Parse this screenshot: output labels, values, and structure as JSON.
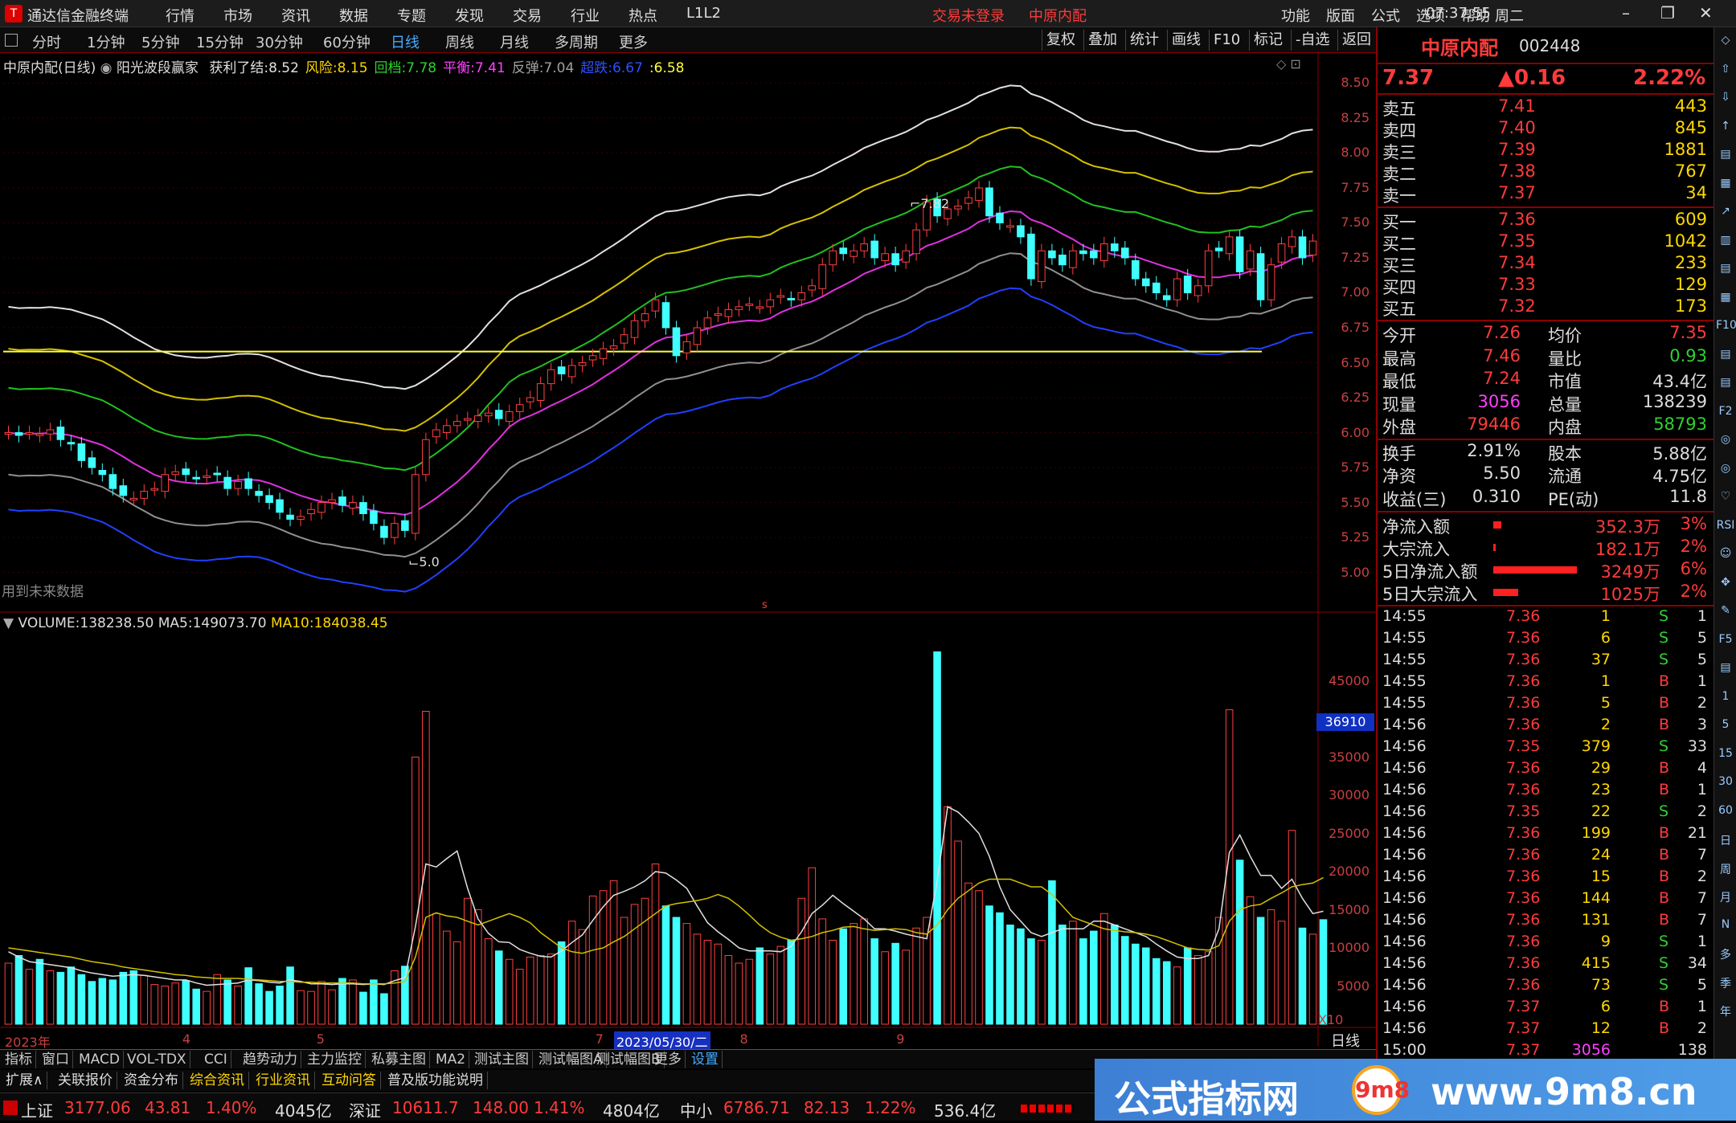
{
  "titlebar": {
    "app": "通达信金融终端",
    "menus": [
      "行情",
      "市场",
      "资讯",
      "数据",
      "专题",
      "发现",
      "交易",
      "行业",
      "热点",
      "L1L2"
    ],
    "status_login": "交易未登录",
    "stock": "中原内配",
    "right_menus": [
      "功能",
      "版面",
      "公式",
      "选项",
      "帮助"
    ],
    "time": "07:37:55",
    "weekday": "周二",
    "win": [
      "–",
      "❐",
      "✕"
    ]
  },
  "toolbar": {
    "periods": [
      "分时",
      "1分钟",
      "5分钟",
      "15分钟",
      "30分钟",
      "60分钟",
      "日线",
      "周线",
      "月线",
      "多周期",
      "更多"
    ],
    "active": "日线",
    "right": [
      "复权",
      "叠加",
      "统计",
      "画线",
      "F10",
      "标记",
      "-自选",
      "返回"
    ]
  },
  "indicator_line": {
    "name": "中原内配(日线)",
    "formula": "阳光波段赢家",
    "items": [
      {
        "label": "获利了结:",
        "value": "8.52",
        "color": "#e0e0e0"
      },
      {
        "label": "风险:",
        "value": "8.15",
        "color": "#ffd700"
      },
      {
        "label": "回档:",
        "value": "7.78",
        "color": "#30d030"
      },
      {
        "label": "平衡:",
        "value": "7.41",
        "color": "#ff40ff"
      },
      {
        "label": "反弹:",
        "value": "7.04",
        "color": "#a0a0a0"
      },
      {
        "label": "超跌:",
        "value": "6.67",
        "color": "#3050ff"
      },
      {
        "label": ":",
        "value": "6.58",
        "color": "#ffff40"
      }
    ]
  },
  "price_axis": [
    "8.50",
    "8.25",
    "8.00",
    "7.75",
    "7.50",
    "7.25",
    "7.00",
    "6.75",
    "6.50",
    "6.25",
    "6.00",
    "5.75",
    "5.50",
    "5.25",
    "5.00"
  ],
  "annotations": {
    "high": "7.82",
    "low": "5.0",
    "future": "用到未来数据",
    "s_mark": "s"
  },
  "volume_line": {
    "label": "VOLUME:",
    "value": "138238.50",
    "ma5_label": "MA5:",
    "ma5": "149073.70",
    "ma10_label": "MA10:",
    "ma10": "184038.45"
  },
  "volume_axis": [
    "45000",
    "40000",
    "35000",
    "30000",
    "25000",
    "20000",
    "15000",
    "10000",
    "5000"
  ],
  "volume_cursor": "36910",
  "volume_unit": "X10",
  "date_axis": {
    "labels": [
      "2023年",
      "4",
      "5",
      "7",
      "8",
      "9"
    ],
    "cursor": "2023/05/30/二",
    "period": "日线"
  },
  "bottom_tabs": [
    "指标",
    "窗口",
    "MACD",
    "VOL-TDX",
    "CCI",
    "趋势动力",
    "主力监控",
    "私募主图",
    "MA2",
    "测试主图",
    "测试幅图A",
    "测试幅图B",
    "更多",
    "设置"
  ],
  "bottom_tabs2": [
    "扩展∧",
    "关联报价",
    "资金分布",
    "综合资讯",
    "行业资讯",
    "互动问答",
    "普及版功能说明"
  ],
  "statusbar": [
    {
      "name": "上证",
      "v": "3177.06",
      "c": "43.81",
      "p": "1.40%",
      "amt": "4045亿"
    },
    {
      "name": "深证",
      "v": "10611.7",
      "c": "148.00",
      "p": "1.41%",
      "amt": "4804亿"
    },
    {
      "name": "中小",
      "v": "6786.71",
      "c": "82.13",
      "p": "1.22%",
      "amt": "536.4亿"
    }
  ],
  "quote": {
    "name": "中原内配",
    "code": "002448",
    "price": "7.37",
    "change": "▲0.16",
    "pct": "2.22%",
    "asks": [
      [
        "卖五",
        "7.41",
        "443"
      ],
      [
        "卖四",
        "7.40",
        "845"
      ],
      [
        "卖三",
        "7.39",
        "1881"
      ],
      [
        "卖二",
        "7.38",
        "767"
      ],
      [
        "卖一",
        "7.37",
        "34"
      ]
    ],
    "bids": [
      [
        "买一",
        "7.36",
        "609"
      ],
      [
        "买二",
        "7.35",
        "1042"
      ],
      [
        "买三",
        "7.34",
        "233"
      ],
      [
        "买四",
        "7.33",
        "129"
      ],
      [
        "买五",
        "7.32",
        "173"
      ]
    ],
    "stats": [
      [
        "今开",
        "7.26",
        "均价",
        "7.35"
      ],
      [
        "最高",
        "7.46",
        "量比",
        "0.93"
      ],
      [
        "最低",
        "7.24",
        "市值",
        "43.4亿"
      ],
      [
        "现量",
        "3056",
        "总量",
        "138239"
      ],
      [
        "外盘",
        "79446",
        "内盘",
        "58793"
      ]
    ],
    "fund": [
      [
        "换手",
        "2.91%",
        "股本",
        "5.88亿"
      ],
      [
        "净资",
        "5.50",
        "流通",
        "4.75亿"
      ],
      [
        "收益(三)",
        "0.310",
        "PE(动)",
        "11.8"
      ]
    ],
    "flow": [
      {
        "label": "净流入额",
        "bar": 0.1,
        "v": "352.3万",
        "p": "3%"
      },
      {
        "label": "大宗流入",
        "bar": 0.03,
        "v": "182.1万",
        "p": "2%"
      },
      {
        "label": "5日净流入额",
        "bar": 1.0,
        "v": "3249万",
        "p": "6%"
      },
      {
        "label": "5日大宗流入",
        "bar": 0.3,
        "v": "1025万",
        "p": "2%"
      }
    ],
    "ticks": [
      [
        "14:55",
        "7.36",
        "1",
        "S",
        "1"
      ],
      [
        "14:55",
        "7.36",
        "6",
        "S",
        "5"
      ],
      [
        "14:55",
        "7.36",
        "37",
        "S",
        "5"
      ],
      [
        "14:55",
        "7.36",
        "1",
        "B",
        "1"
      ],
      [
        "14:55",
        "7.36",
        "5",
        "B",
        "2"
      ],
      [
        "14:56",
        "7.36",
        "2",
        "B",
        "3"
      ],
      [
        "14:56",
        "7.35",
        "379",
        "S",
        "33"
      ],
      [
        "14:56",
        "7.36",
        "29",
        "B",
        "4"
      ],
      [
        "14:56",
        "7.36",
        "23",
        "B",
        "1"
      ],
      [
        "14:56",
        "7.35",
        "22",
        "S",
        "2"
      ],
      [
        "14:56",
        "7.36",
        "199",
        "B",
        "21"
      ],
      [
        "14:56",
        "7.36",
        "24",
        "B",
        "7"
      ],
      [
        "14:56",
        "7.36",
        "15",
        "B",
        "2"
      ],
      [
        "14:56",
        "7.36",
        "144",
        "B",
        "7"
      ],
      [
        "14:56",
        "7.36",
        "131",
        "B",
        "7"
      ],
      [
        "14:56",
        "7.36",
        "9",
        "S",
        "1"
      ],
      [
        "14:56",
        "7.36",
        "415",
        "S",
        "34"
      ],
      [
        "14:56",
        "7.36",
        "73",
        "S",
        "5"
      ],
      [
        "14:56",
        "7.37",
        "6",
        "B",
        "1"
      ],
      [
        "14:56",
        "7.37",
        "12",
        "B",
        "2"
      ],
      [
        "15:00",
        "7.37",
        "3056",
        "",
        "138"
      ]
    ]
  },
  "sidebar": [
    "◇",
    "⇧",
    "⇩",
    "↑",
    "▤",
    "▦",
    "↗",
    "▥",
    "▤",
    "▦",
    "F10",
    "▤",
    "▤",
    "F2",
    "◎",
    "◎",
    "♡",
    "RSI",
    "☺",
    "✥",
    "✎",
    "F5",
    "▤",
    "1",
    "5",
    "15",
    "30",
    "60",
    "日",
    "周",
    "月",
    "N",
    "多",
    "季",
    "年"
  ],
  "watermark": {
    "text1": "公式指标网",
    "text2": "www.9m8.cn",
    "logo": "9m8"
  },
  "chart_data": {
    "type": "candlestick",
    "ylim": [
      4.9,
      8.6
    ],
    "volume_ylim": [
      0,
      50000
    ],
    "volume_unit": "X10",
    "x_labels": [
      "2023年",
      "4",
      "5",
      "7",
      "8",
      "9"
    ],
    "closes": [
      6.0,
      5.98,
      6.0,
      5.99,
      6.02,
      5.95,
      5.92,
      5.8,
      5.75,
      5.7,
      5.6,
      5.55,
      5.53,
      5.58,
      5.6,
      5.7,
      5.72,
      5.7,
      5.68,
      5.69,
      5.7,
      5.6,
      5.65,
      5.6,
      5.55,
      5.5,
      5.43,
      5.38,
      5.4,
      5.45,
      5.5,
      5.52,
      5.48,
      5.5,
      5.42,
      5.35,
      5.25,
      5.35,
      5.3,
      5.7,
      5.95,
      6.02,
      6.05,
      6.08,
      6.1,
      6.12,
      6.14,
      6.1,
      6.15,
      6.2,
      6.25,
      6.35,
      6.45,
      6.42,
      6.48,
      6.5,
      6.55,
      6.6,
      6.62,
      6.7,
      6.8,
      6.85,
      6.95,
      6.75,
      6.55,
      6.65,
      6.75,
      6.82,
      6.85,
      6.88,
      6.9,
      6.92,
      6.9,
      6.95,
      6.98,
      6.95,
      7.0,
      7.05,
      7.2,
      7.3,
      7.28,
      7.3,
      7.35,
      7.25,
      7.28,
      7.2,
      7.3,
      7.45,
      7.65,
      7.55,
      7.6,
      7.62,
      7.68,
      7.75,
      7.55,
      7.5,
      7.48,
      7.4,
      7.1,
      7.3,
      7.25,
      7.2,
      7.3,
      7.28,
      7.25,
      7.35,
      7.3,
      7.25,
      7.1,
      7.05,
      7.0,
      6.95,
      7.1,
      7.0,
      7.05,
      7.3,
      7.3,
      7.4,
      7.15,
      7.3,
      6.95,
      7.2,
      7.35,
      7.4,
      7.25,
      7.37
    ],
    "volumes": [
      8000,
      9000,
      7200,
      8500,
      7000,
      6800,
      7500,
      6500,
      5600,
      6000,
      5800,
      6800,
      7000,
      6400,
      5200,
      5000,
      5400,
      5700,
      4600,
      4300,
      6500,
      5800,
      5000,
      7400,
      5300,
      4300,
      5000,
      7500,
      4400,
      4300,
      5600,
      4500,
      6000,
      5800,
      4200,
      5800,
      4000,
      7000,
      7600,
      35000,
      41000,
      14500,
      12200,
      10800,
      16500,
      15000,
      11200,
      9600,
      8500,
      7200,
      8800,
      9000,
      9200,
      10800,
      13500,
      12400,
      16800,
      17500,
      18800,
      14000,
      15700,
      16500,
      21000,
      15500,
      14000,
      13200,
      11800,
      11000,
      10500,
      9000,
      8000,
      8500,
      10000,
      9200,
      10200,
      11000,
      16500,
      20500,
      13800,
      11000,
      12500,
      13200,
      13800,
      11200,
      9500,
      10600,
      9700,
      12600,
      14000,
      48800,
      28500,
      24000,
      18500,
      17500,
      15500,
      14600,
      13000,
      12500,
      11200,
      11000,
      18800,
      13000,
      13500,
      11200,
      12200,
      14500,
      13000,
      11500,
      10500,
      10000,
      8600,
      8200,
      7500,
      10000,
      9000,
      9500,
      14000,
      41200,
      21500,
      16700,
      14000,
      15000,
      13500,
      25400,
      12600,
      11800,
      13700
    ],
    "ma5_volume": [
      9500,
      8800,
      8200,
      8000,
      7800,
      7600,
      7400,
      7000,
      6700,
      6500,
      6300,
      6400,
      6500,
      6400,
      6200,
      6000,
      5800,
      5800,
      5400,
      5100,
      5200,
      5300,
      5400,
      5800,
      5700,
      5500,
      5400,
      5800,
      5600,
      5300,
      5300,
      5200,
      5300,
      5300,
      5200,
      5300,
      5200,
      5700,
      6100,
      12800,
      21000,
      20600,
      21700,
      22700,
      17800,
      13800,
      11900,
      10800,
      10700,
      9800,
      9300,
      8900,
      8800,
      9600,
      10700,
      11700,
      13600,
      15400,
      16900,
      17400,
      18000,
      18800,
      20000,
      19800,
      18900,
      17800,
      15500,
      13300,
      12100,
      11100,
      10000,
      9600,
      9600,
      9600,
      9500,
      10200,
      12100,
      14500,
      15600,
      16900,
      15800,
      14800,
      13800,
      12500,
      12500,
      12200,
      11800,
      11500,
      11200,
      18800,
      28500,
      27800,
      26500,
      25000,
      22000,
      18000,
      15000,
      13500,
      12000,
      11500,
      12000,
      12500,
      12500,
      12500,
      13500,
      13500,
      13000,
      12500,
      12000,
      11500,
      10500,
      9600,
      8800,
      8600,
      8600,
      9000,
      12500,
      22500,
      24800,
      22000,
      19500,
      19500,
      17800,
      19000,
      16500,
      14500,
      14800
    ],
    "ma10_volume": [
      10000,
      9800,
      9600,
      9400,
      9200,
      9000,
      8800,
      8500,
      8200,
      8000,
      7800,
      7500,
      7300,
      7100,
      6900,
      6700,
      6500,
      6400,
      6200,
      6100,
      6000,
      6000,
      6000,
      5900,
      5800,
      5700,
      5600,
      5600,
      5500,
      5500,
      5400,
      5400,
      5400,
      5400,
      5300,
      5300,
      5300,
      5400,
      5600,
      8800,
      14000,
      14600,
      14200,
      14000,
      13500,
      13000,
      13500,
      14000,
      14500,
      14000,
      13300,
      12000,
      11000,
      10000,
      9500,
      9300,
      9700,
      10000,
      10800,
      11500,
      12500,
      13500,
      14500,
      15500,
      15800,
      16000,
      16200,
      16500,
      17000,
      16500,
      15500,
      14300,
      13000,
      12000,
      11400,
      11000,
      11200,
      11500,
      12000,
      12300,
      12700,
      12800,
      12500,
      12300,
      12400,
      12500,
      12400,
      12000,
      11800,
      13000,
      15000,
      16500,
      17500,
      18500,
      19000,
      19000,
      19000,
      18500,
      18000,
      18000,
      17000,
      15500,
      14000,
      13500,
      13000,
      12500,
      12300,
      12100,
      12000,
      11800,
      11500,
      11000,
      10500,
      10000,
      9800,
      9700,
      10300,
      13500,
      15000,
      15500,
      15700,
      16500,
      17200,
      18000,
      18300,
      18500,
      19200
    ]
  }
}
